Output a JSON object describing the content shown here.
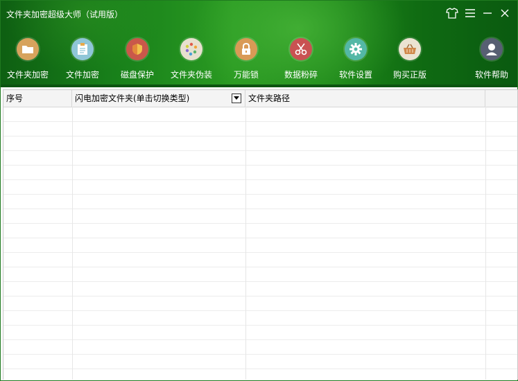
{
  "app": {
    "title": "文件夹加密超级大师（试用版）"
  },
  "toolbar": {
    "items": [
      {
        "label": "文件夹加密",
        "icon": "folder-encrypt-icon",
        "color": "#d7a35d"
      },
      {
        "label": "文件加密",
        "icon": "file-encrypt-icon",
        "color": "#8fc6d8"
      },
      {
        "label": "磁盘保护",
        "icon": "disk-shield-icon",
        "color": "#c9584a"
      },
      {
        "label": "文件夹伪装",
        "icon": "folder-disguise-icon",
        "color": "#e8e0cf"
      },
      {
        "label": "万能锁",
        "icon": "padlock-icon",
        "color": "#d99a56"
      },
      {
        "label": "数据粉碎",
        "icon": "scissors-icon",
        "color": "#c95252"
      },
      {
        "label": "软件设置",
        "icon": "gear-icon",
        "color": "#53b8a6"
      },
      {
        "label": "购买正版",
        "icon": "basket-icon",
        "color": "#ebe3d2"
      },
      {
        "label": "软件帮助",
        "icon": "user-help-icon",
        "color": "#575f73"
      }
    ]
  },
  "table": {
    "columns": [
      {
        "label": "序号"
      },
      {
        "label": "闪电加密文件夹(单击切换类型)"
      },
      {
        "label": "文件夹路径"
      },
      {
        "label": ""
      }
    ],
    "rows": []
  }
}
